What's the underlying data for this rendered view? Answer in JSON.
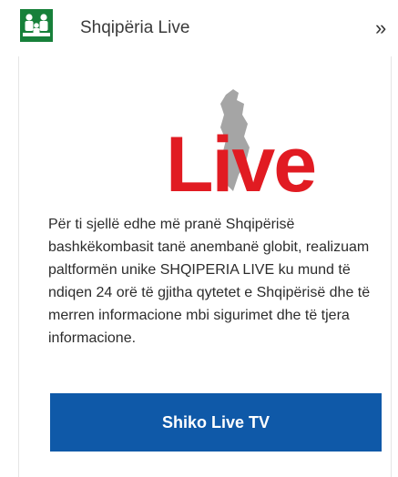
{
  "header": {
    "title": "Shqipëria Live",
    "expand_icon": "double-chevron-right-icon",
    "app_icon": "family-icon"
  },
  "logo": {
    "text": "Live",
    "color": "#e11b22"
  },
  "body": {
    "description": "Për ti sjellë edhe më pranë Shqipërisë bashkëkombasit tanë anembanë globit, realizuam paltformën unike SHQIPERIA LIVE ku mund të ndiqen 24 orë të gjitha qytetet e Shqipërisë dhe të merren informacione mbi sigurimet dhe të tjera informacione."
  },
  "cta": {
    "label": "Shiko Live TV",
    "color": "#0f59a8"
  }
}
